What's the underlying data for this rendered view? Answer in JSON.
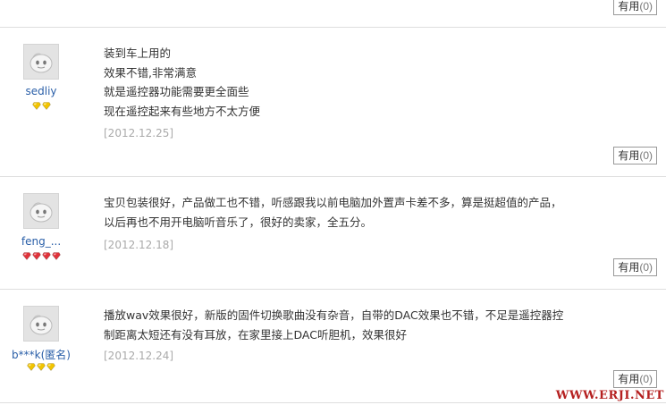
{
  "useful_label": "有用",
  "top_useful_count": "(0)",
  "reviews": [
    {
      "username": "sedliy",
      "level_gem": "gold",
      "level_count": 2,
      "lines": [
        "装到车上用的",
        "效果不错,非常满意",
        "就是遥控器功能需要更全面些",
        "现在遥控起来有些地方不太方便"
      ],
      "date": "[2012.12.25]",
      "useful_count": "(0)"
    },
    {
      "username": "feng_...",
      "level_gem": "red",
      "level_count": 4,
      "lines": [
        "宝贝包装很好，产品做工也不错，听感跟我以前电脑加外置声卡差不多，算是挺超值的产品，",
        "以后再也不用开电脑听音乐了，很好的卖家，全五分。"
      ],
      "date": "[2012.12.18]",
      "useful_count": "(0)"
    },
    {
      "username": "b***k(匿名)",
      "level_gem": "gold",
      "level_count": 3,
      "lines": [
        "播放wav效果很好，新版的固件切换歌曲没有杂音，自带的DAC效果也不错，不足是遥控器控",
        "制距离太短还有没有耳放，在家里接上DAC听胆机，效果很好"
      ],
      "date": "[2012.12.24]",
      "useful_count": "(0)"
    }
  ],
  "watermark": "WWW.ERJI.NET",
  "colors": {
    "gold_gem": "#f2c400",
    "red_gem": "#e0323a",
    "username": "#2a5fa8",
    "date": "#aaaaaa",
    "watermark": "#b52020"
  }
}
